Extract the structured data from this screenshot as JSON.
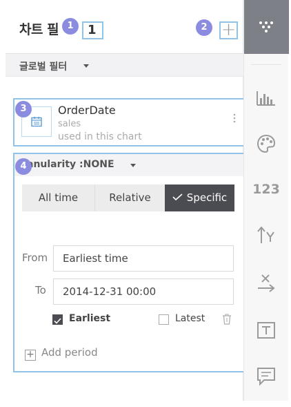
{
  "header": {
    "title": "차트 필",
    "filter_count": "1",
    "add_symbol": "+"
  },
  "badges": [
    "1",
    "2",
    "3",
    "4"
  ],
  "global_filter": {
    "label": "글로벌 필터"
  },
  "field_card": {
    "name": "OrderDate",
    "source": "sales",
    "usage": "used in this chart"
  },
  "granularity": {
    "label": "anularity :NONE",
    "segments": {
      "all_time": "All time",
      "relative": "Relative",
      "specific": "Specific"
    },
    "selected_segment": "Specific",
    "from_label": "From",
    "from_value": "Earliest time",
    "to_label": "To",
    "to_value": "2014-12-31 00:00",
    "earliest_label": "Earliest",
    "earliest_checked": true,
    "latest_label": "Latest",
    "latest_checked": false,
    "add_period_label": "Add period",
    "add_symbol": "+"
  },
  "toolbar": {
    "numeric_label": "123",
    "items": [
      "filter-icon",
      "bar-chart-icon",
      "palette-icon",
      "number-format",
      "y-axis-icon",
      "x-axis-icon",
      "text-icon",
      "comment-icon"
    ]
  },
  "colors": {
    "highlight_border": "#8fc3ea",
    "badge": "#8b8ce0",
    "active_segment": "#4b4b52",
    "toolbar_active": "#7d8086"
  }
}
